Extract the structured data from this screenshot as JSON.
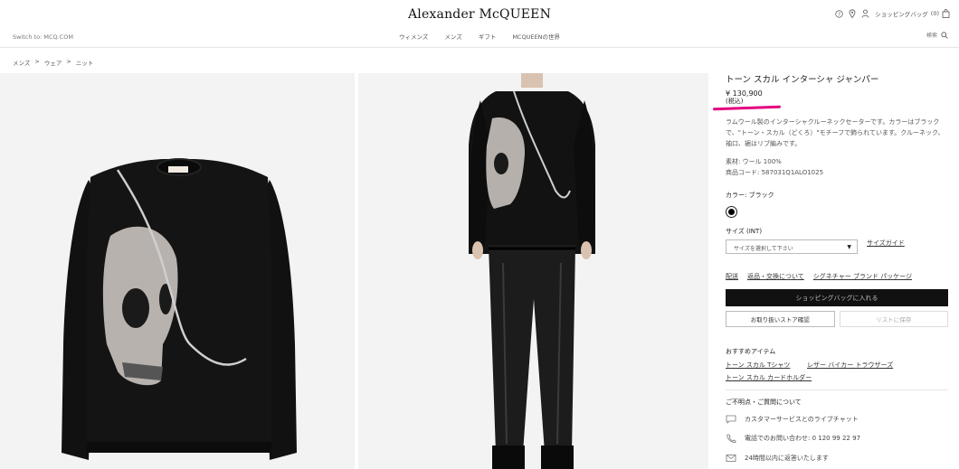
{
  "header": {
    "logo": "Alexander McQUEEN",
    "switch_link": "Switch to: MCQ.COM",
    "nav": [
      "ウィメンズ",
      "メンズ",
      "ギフト",
      "MCQUEENの世界"
    ],
    "bag_label": "ショッピングバッグ",
    "bag_count": "(0)",
    "search_label": "検索"
  },
  "breadcrumb": [
    "メンズ",
    ">",
    "ウェア",
    ">",
    "ニット"
  ],
  "product": {
    "title": "トーン スカル インターシャ ジャンパー",
    "price": "¥ 130,900",
    "tax": "(税込)",
    "description": "ラムウール製のインターシャクルーネックセーターです。カラーはブラックで、\"トーン・スカル（どくろ）\"モチーフで飾られています。クルーネック、袖口、裾はリブ編みです。",
    "material": "素材: ウール 100%",
    "code": "商品コード:  587031Q1ALO1025",
    "color_label": "カラー: ブラック",
    "swatch_color": "#000000",
    "size_label": "サイズ  (INT)",
    "size_placeholder": "サイズを選択して下さい",
    "size_guide": "サイズガイド",
    "links": [
      "配送",
      "返品・交換について",
      "シグネチャー ブランド パッケージ"
    ],
    "add_to_bag": "ショッピングバッグに入れる",
    "store_check": "お取り扱いストア確認",
    "wishlist": "リストに保存"
  },
  "recommended": {
    "heading": "おすすめアイテム",
    "items": [
      "トーン スカル Tシャツ",
      "レザー バイカー トラウザーズ",
      "トーン スカル カードホルダー"
    ]
  },
  "contact": {
    "heading": "ご不明点・ご質問について",
    "chat": "カスタマーサービスとのライブチャット",
    "phone": "電話でのお問い合わせ: 0 120 99 22 97",
    "mail": "24時間以内に返答いたします"
  },
  "colors": {
    "accent_underline": "#e4007f",
    "button_bg": "#111111"
  }
}
